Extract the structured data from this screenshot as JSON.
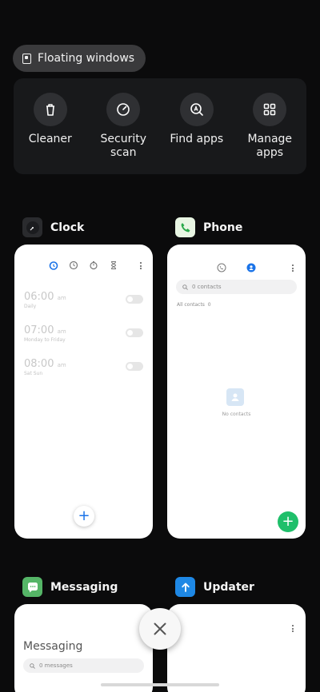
{
  "floating_windows": {
    "label": "Floating windows"
  },
  "tools": [
    {
      "label": "Cleaner",
      "icon": "trash-icon"
    },
    {
      "label": "Security\nscan",
      "icon": "security-scan-icon"
    },
    {
      "label": "Find apps",
      "icon": "find-apps-icon"
    },
    {
      "label": "Manage\napps",
      "icon": "grid-icon"
    }
  ],
  "apps": {
    "clock": {
      "name": "Clock",
      "alarms": [
        {
          "time": "06:00",
          "ampm": "am",
          "repeat": "Daily"
        },
        {
          "time": "07:00",
          "ampm": "am",
          "repeat": "Monday to Friday"
        },
        {
          "time": "08:00",
          "ampm": "am",
          "repeat": "Sat Sun"
        }
      ],
      "fab": "+"
    },
    "phone": {
      "name": "Phone",
      "search_placeholder": "0 contacts",
      "filter": "All contacts",
      "filter_count": "0",
      "empty_text": "No contacts",
      "fab": "+"
    },
    "messaging": {
      "name": "Messaging",
      "title": "Messaging",
      "search_placeholder": "0 messages"
    },
    "updater": {
      "name": "Updater"
    }
  },
  "colors": {
    "accent_blue": "#1a73e8",
    "fab_green": "#1fbf6a",
    "background": "#0b0b0c"
  }
}
